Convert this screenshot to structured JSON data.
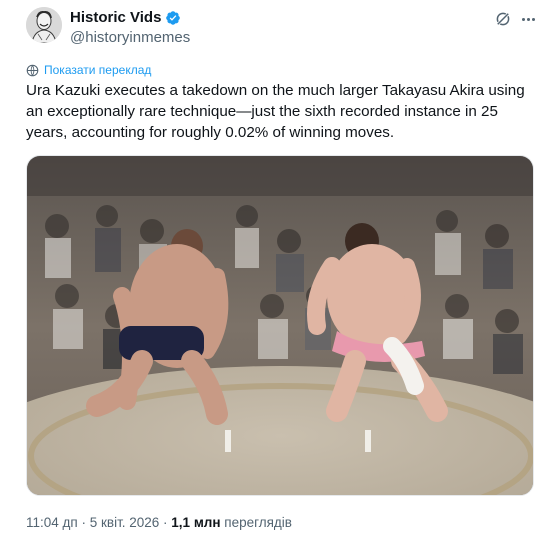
{
  "author": {
    "display_name": "Historic Vids",
    "handle": "@historyinmemes",
    "verified": true,
    "avatar_icon": "bust-statue-avatar"
  },
  "actions": {
    "grok_icon": "grok-icon",
    "more_icon": "more-dots-icon"
  },
  "translate": {
    "label": "Показати переклад",
    "icon": "globe-icon"
  },
  "tweet": {
    "text": "Ura Kazuki executes a takedown on the much larger Takayasu Akira using an exceptionally rare technique—just the sixth recorded instance in 25 years, accounting for roughly 0.02% of winning moves."
  },
  "media": {
    "type": "video",
    "description_icon": "sumo-video-thumbnail"
  },
  "meta": {
    "time": "11:04 дп",
    "separator": " · ",
    "date": "5 квіт. 2026",
    "views_count": "1,1 млн",
    "views_label": " переглядів"
  },
  "colors": {
    "accent": "#1d9bf0",
    "text": "#0f1419",
    "secondary": "#536471"
  }
}
